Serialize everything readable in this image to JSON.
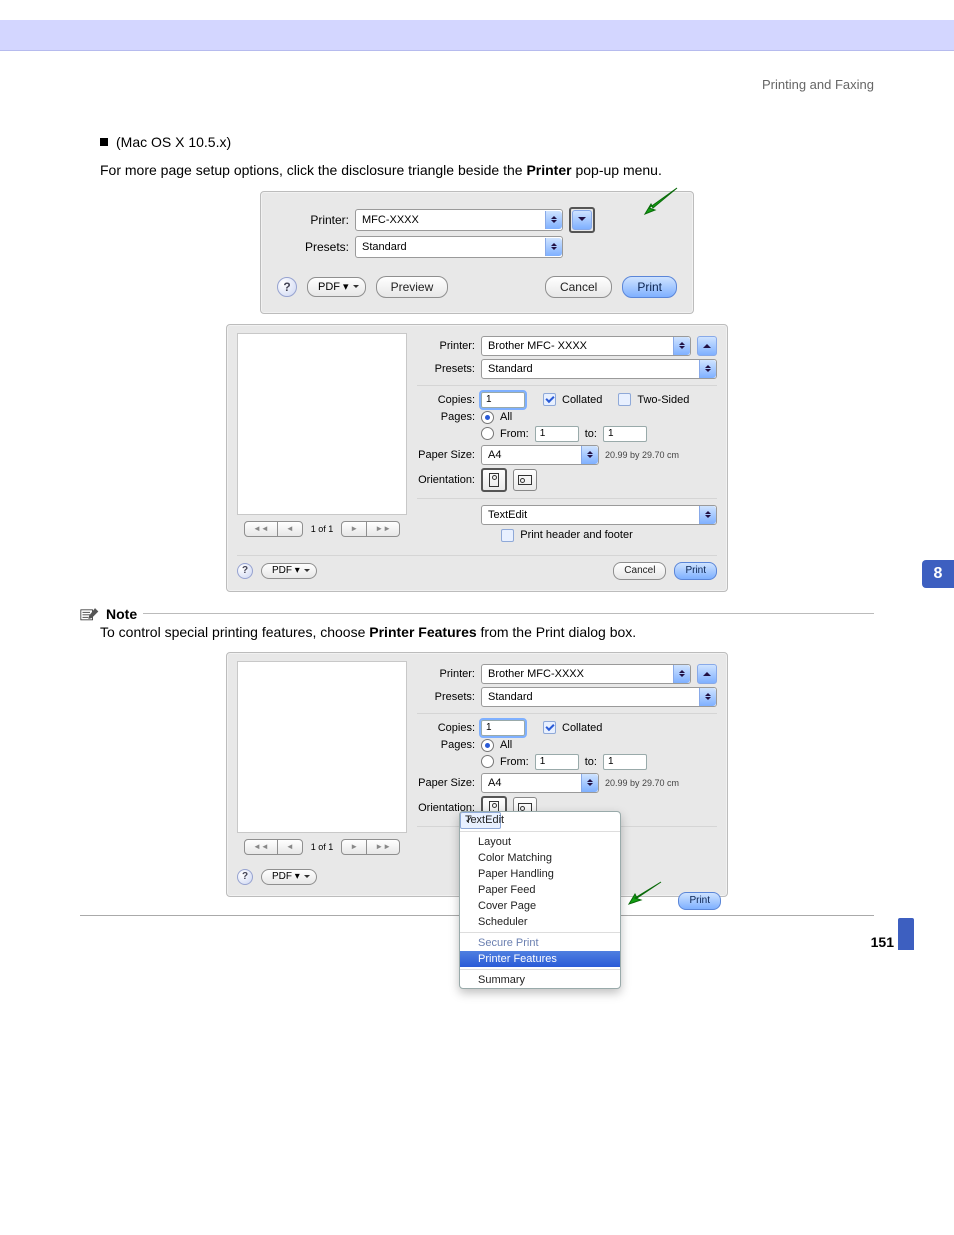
{
  "breadcrumb": "Printing and Faxing",
  "sidetab": "8",
  "page_number": "151",
  "section": {
    "os_label": "(Mac OS X 10.5.x)",
    "body_prefix": "For more page setup options, click the disclosure triangle beside the ",
    "body_bold": "Printer",
    "body_suffix": " pop-up menu."
  },
  "note": {
    "heading": "Note",
    "body_prefix": "To control special printing features, choose ",
    "body_bold": "Printer Features",
    "body_suffix": " from the Print dialog box."
  },
  "dlg1": {
    "labels": {
      "printer": "Printer:",
      "presets": "Presets:"
    },
    "printer_value": "MFC-XXXX",
    "presets_value": "Standard",
    "pdf": "PDF ▾",
    "preview": "Preview",
    "cancel": "Cancel",
    "print": "Print",
    "help_glyph": "?"
  },
  "dlg2": {
    "labels": {
      "printer": "Printer:",
      "presets": "Presets:",
      "copies": "Copies:",
      "pages": "Pages:",
      "from": "From:",
      "to": "to:",
      "paper_size": "Paper Size:",
      "orientation": "Orientation:"
    },
    "printer_value": "Brother  MFC- XXXX",
    "presets_value": "Standard",
    "copies_value": "1",
    "collated_label": "Collated",
    "two_sided_label": "Two-Sided",
    "pages_all_label": "All",
    "from_value": "1",
    "to_value": "1",
    "paper_size_value": "A4",
    "paper_size_dims": "20.99 by 29.70 cm",
    "panel_value": "TextEdit",
    "print_header_label": "Print header and footer",
    "preview_counter": "1 of 1",
    "pdf": "PDF ▾",
    "cancel": "Cancel",
    "print": "Print",
    "help_glyph": "?"
  },
  "dlg3": {
    "labels": {
      "printer": "Printer:",
      "presets": "Presets:",
      "copies": "Copies:",
      "pages": "Pages:",
      "from": "From:",
      "to": "to:",
      "paper_size": "Paper Size:",
      "orientation": "Orientation:"
    },
    "printer_value": "Brother MFC-XXXX",
    "presets_value": "Standard",
    "copies_value": "1",
    "collated_label": "Collated",
    "pages_all_label": "All",
    "from_value": "1",
    "to_value": "1",
    "paper_size_value": "A4",
    "paper_size_dims": "20.99 by 29.70 cm",
    "preview_counter": "1 of 1",
    "pdf": "PDF ▾",
    "print": "Print",
    "help_glyph": "?",
    "menu": {
      "current": "TextEdit",
      "items": [
        "Layout",
        "Color Matching",
        "Paper Handling",
        "Paper Feed",
        "Cover Page",
        "Scheduler"
      ],
      "scroll_item": "Secure Print",
      "selected": "Printer Features",
      "after": "Summary"
    }
  }
}
